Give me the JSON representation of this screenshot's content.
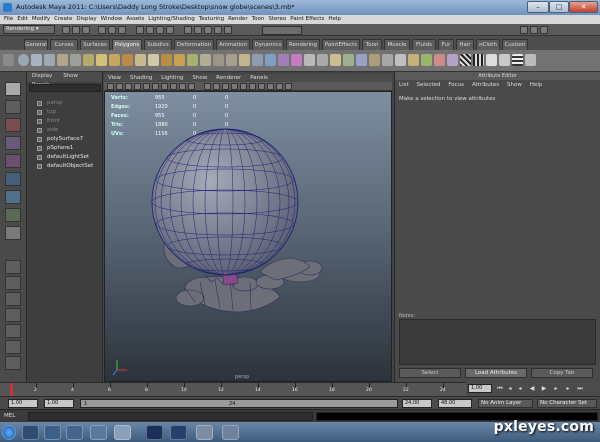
{
  "window": {
    "title": "Autodesk Maya 2011: C:\\Users\\Daddy Long Stroke\\Desktop\\snow globe\\scenes\\3.mb*"
  },
  "menubar": [
    "File",
    "Edit",
    "Modify",
    "Create",
    "Display",
    "Window",
    "Assets",
    "Lighting/Shading",
    "Texturing",
    "Render",
    "Toon",
    "Stereo",
    "Paint Effects",
    "Help"
  ],
  "statusline": {
    "mode": "Rendering"
  },
  "shelf_tabs": [
    "General",
    "Curves",
    "Surfaces",
    "Polygons",
    "Subdivs",
    "Deformation",
    "Animation",
    "Dynamics",
    "Rendering",
    "PaintEffects",
    "Toon",
    "Muscle",
    "Fluids",
    "Fur",
    "Hair",
    "nCloth",
    "Custom"
  ],
  "active_shelf_tab": "Polygons",
  "outliner": {
    "menu": [
      "Display",
      "Show",
      "Panels"
    ],
    "items": [
      {
        "label": "persp",
        "dim": true
      },
      {
        "label": "top",
        "dim": true
      },
      {
        "label": "front",
        "dim": true
      },
      {
        "label": "side",
        "dim": true
      },
      {
        "label": "polySurface7",
        "dim": false
      },
      {
        "label": "pSphere1",
        "dim": false
      },
      {
        "label": "defaultLightSet",
        "dim": false
      },
      {
        "label": "defaultObjectSet",
        "dim": false
      }
    ]
  },
  "viewport": {
    "menu": [
      "View",
      "Shading",
      "Lighting",
      "Show",
      "Renderer",
      "Panels"
    ],
    "hud": [
      {
        "label": "Verts:",
        "value": "955",
        "c1": "0",
        "c2": "0"
      },
      {
        "label": "Edges:",
        "value": "1920",
        "c1": "0",
        "c2": "0"
      },
      {
        "label": "Faces:",
        "value": "955",
        "c1": "0",
        "c2": "0"
      },
      {
        "label": "Tris:",
        "value": "1880",
        "c1": "0",
        "c2": "0"
      },
      {
        "label": "UVs:",
        "value": "1156",
        "c1": "0",
        "c2": "0"
      }
    ],
    "camera_label": "persp"
  },
  "attribute_editor": {
    "header": "Attribute Editor",
    "menu": [
      "List",
      "Selected",
      "Focus",
      "Attributes",
      "Show",
      "Help"
    ],
    "message": "Make a selection to view attributes",
    "notes_label": "Notes:",
    "buttons": [
      "Select",
      "Load Attributes",
      "Copy Tab"
    ]
  },
  "timeline": {
    "ticks": [
      "2",
      "4",
      "6",
      "8",
      "10",
      "12",
      "14",
      "16",
      "18",
      "20",
      "22",
      "24"
    ],
    "current_frame": "1.00"
  },
  "range": {
    "start": "1.00",
    "start2": "1.00",
    "slider_start": "1",
    "slider_end": "24",
    "end": "24.00",
    "end2": "48.00",
    "anim_layer": "No Anim Layer",
    "character_set": "No Character Set"
  },
  "cmdline": {
    "label": "MEL"
  },
  "watermark": "pxleyes.com"
}
